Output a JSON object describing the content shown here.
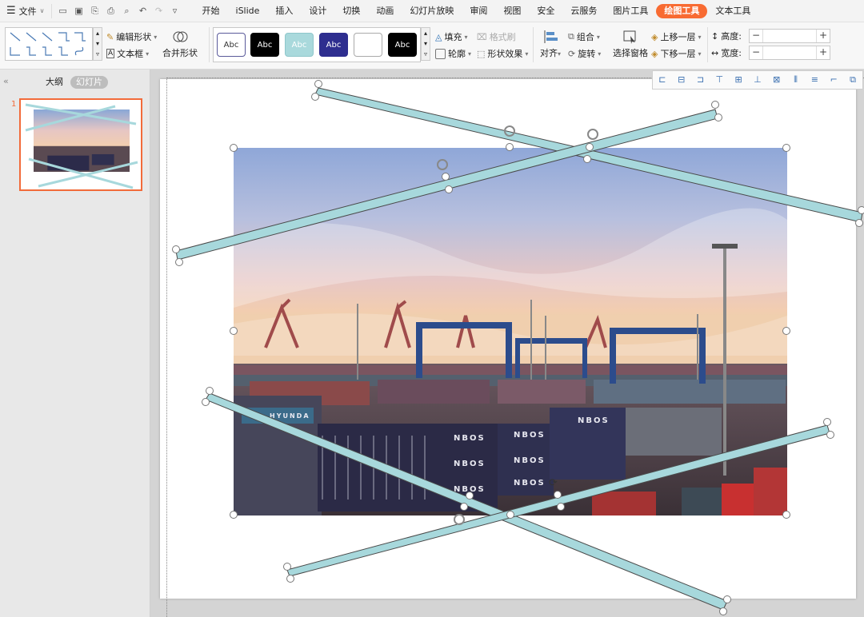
{
  "menubar": {
    "file_label": "文件",
    "tabs": [
      "开始",
      "iSlide",
      "插入",
      "设计",
      "切换",
      "动画",
      "幻灯片放映",
      "审阅",
      "视图",
      "安全",
      "云服务",
      "图片工具",
      "绘图工具",
      "文本工具"
    ],
    "active_tab": "绘图工具",
    "accent_color": "#f86b32"
  },
  "ribbon": {
    "edit_shape": "编辑形状",
    "text_box": "文本框",
    "merge_shapes": "合并形状",
    "style_swatches": [
      {
        "label": "Abc",
        "bg": "#ffffff",
        "fg": "#333333",
        "border": "#5a5a9a"
      },
      {
        "label": "Abc",
        "bg": "#000000",
        "fg": "#ffffff",
        "border": "#000000"
      },
      {
        "label": "Abc",
        "bg": "#a9d9dc",
        "fg": "#ffffff",
        "border": "#8fc7cb"
      },
      {
        "label": "Abc",
        "bg": "#2e2e8f",
        "fg": "#ffffff",
        "border": "#2e2e8f"
      },
      {
        "label": "",
        "bg": "#ffffff",
        "fg": "#333333",
        "border": "#aaaaaa"
      },
      {
        "label": "Abc",
        "bg": "#000000",
        "fg": "#ffffff",
        "border": "#000000"
      }
    ],
    "fill": "填充",
    "format_painter": "格式刷",
    "outline": "轮廓",
    "shape_effects": "形状效果",
    "align": "对齐",
    "group": "组合",
    "rotate": "旋转",
    "selection_pane": "选择窗格",
    "bring_forward": "上移一层",
    "send_backward": "下移一层",
    "height_label": "高度:",
    "width_label": "宽度:",
    "minus": "−",
    "plus": "+"
  },
  "sidebar": {
    "outline_tab": "大纲",
    "slides_tab": "幻灯片",
    "slide_number": "1",
    "collapse": "«"
  },
  "photo_text": {
    "container_label_1": "NBOS",
    "container_label_2": "NBOS",
    "container_label_3": "NBOS",
    "container_label_4": "NBOS",
    "container_label_5": "NBOS",
    "container_label_6": "NBOS",
    "container_label_7": "NBOS",
    "hyundai": "HYUNDA"
  },
  "shape_color": "#a7d8dc"
}
